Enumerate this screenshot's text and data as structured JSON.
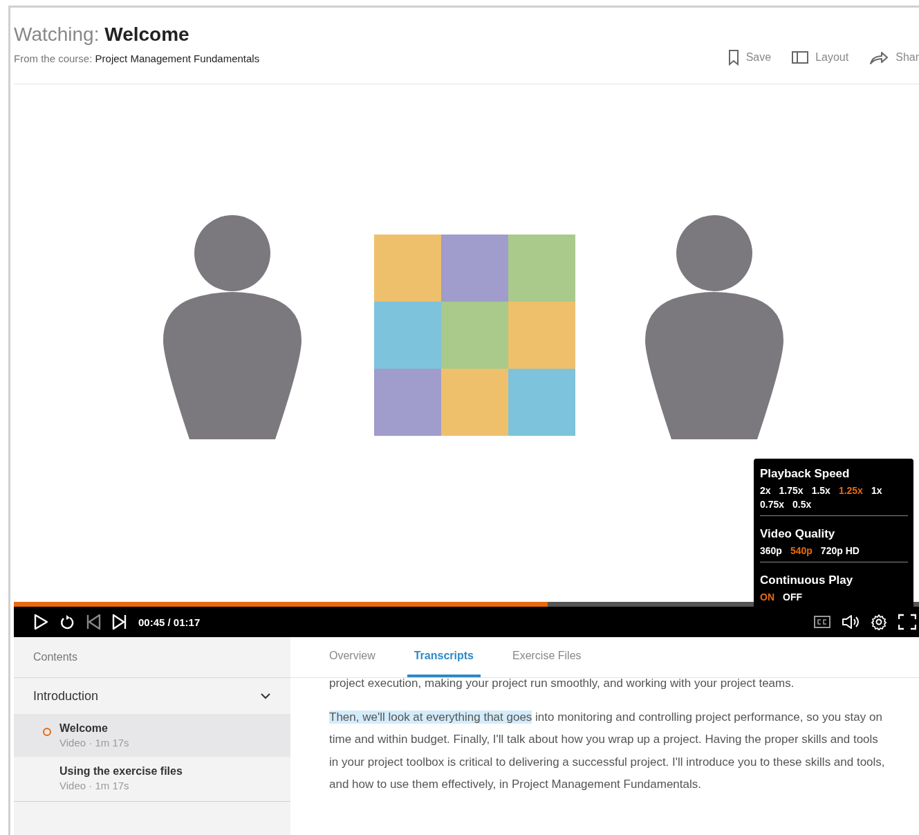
{
  "header": {
    "watching_label": "Watching:",
    "title": "Welcome",
    "course_label": "From the course:",
    "course": "Project Management Fundamentals",
    "actions": [
      {
        "kind": "save",
        "label": "Save"
      },
      {
        "kind": "layout",
        "label": "Layout"
      },
      {
        "kind": "share",
        "label": "Shar"
      }
    ]
  },
  "player": {
    "progress": {
      "level": 0.59
    },
    "time": "00:45 / 01:17",
    "settings": {
      "sections": [
        {
          "title": "Playback Speed",
          "options": [
            {
              "label": "2x",
              "selected": false
            },
            {
              "label": "1.75x",
              "selected": false
            },
            {
              "label": "1.5x",
              "selected": false
            },
            {
              "label": "1.25x",
              "selected": true
            },
            {
              "label": "1x",
              "selected": false
            },
            {
              "label": "0.75x",
              "selected": false
            },
            {
              "label": "0.5x",
              "selected": false
            }
          ]
        },
        {
          "title": "Video Quality",
          "options": [
            {
              "label": "360p",
              "selected": false
            },
            {
              "label": "540p",
              "selected": true
            },
            {
              "label": "720p HD",
              "selected": false
            }
          ]
        },
        {
          "title": "Continuous Play",
          "options": [
            {
              "label": "ON",
              "selected": true
            },
            {
              "label": "OFF",
              "selected": false
            }
          ]
        }
      ]
    }
  },
  "sidebar": {
    "title": "Contents",
    "sections": [
      {
        "title": "Introduction",
        "expanded": true,
        "items": [
          {
            "title": "Welcome",
            "meta": "Video · 1m 17s",
            "selected": true
          },
          {
            "title": "Using the exercise files",
            "meta": "Video · 1m 17s",
            "selected": false
          }
        ]
      }
    ]
  },
  "tabs": [
    {
      "label": "Overview",
      "selected": false
    },
    {
      "label": "Transcripts",
      "selected": true
    },
    {
      "label": "Exercise Files",
      "selected": false
    }
  ],
  "transcript": [
    {
      "text": "project execution, making your project run smoothly, and working with your project teams."
    },
    {
      "highlighted": "Then, we'll look at everything that goes",
      "text": " into monitoring and controlling project performance, so you stay on time and within budget. Finally, I'll talk about how you wrap up a project. Having the proper skills and tools in your project toolbox is critical to delivering a successful project. I'll introduce you to these skills and tools, and how to use them effectively, in Project Management Fundamentals."
    }
  ]
}
